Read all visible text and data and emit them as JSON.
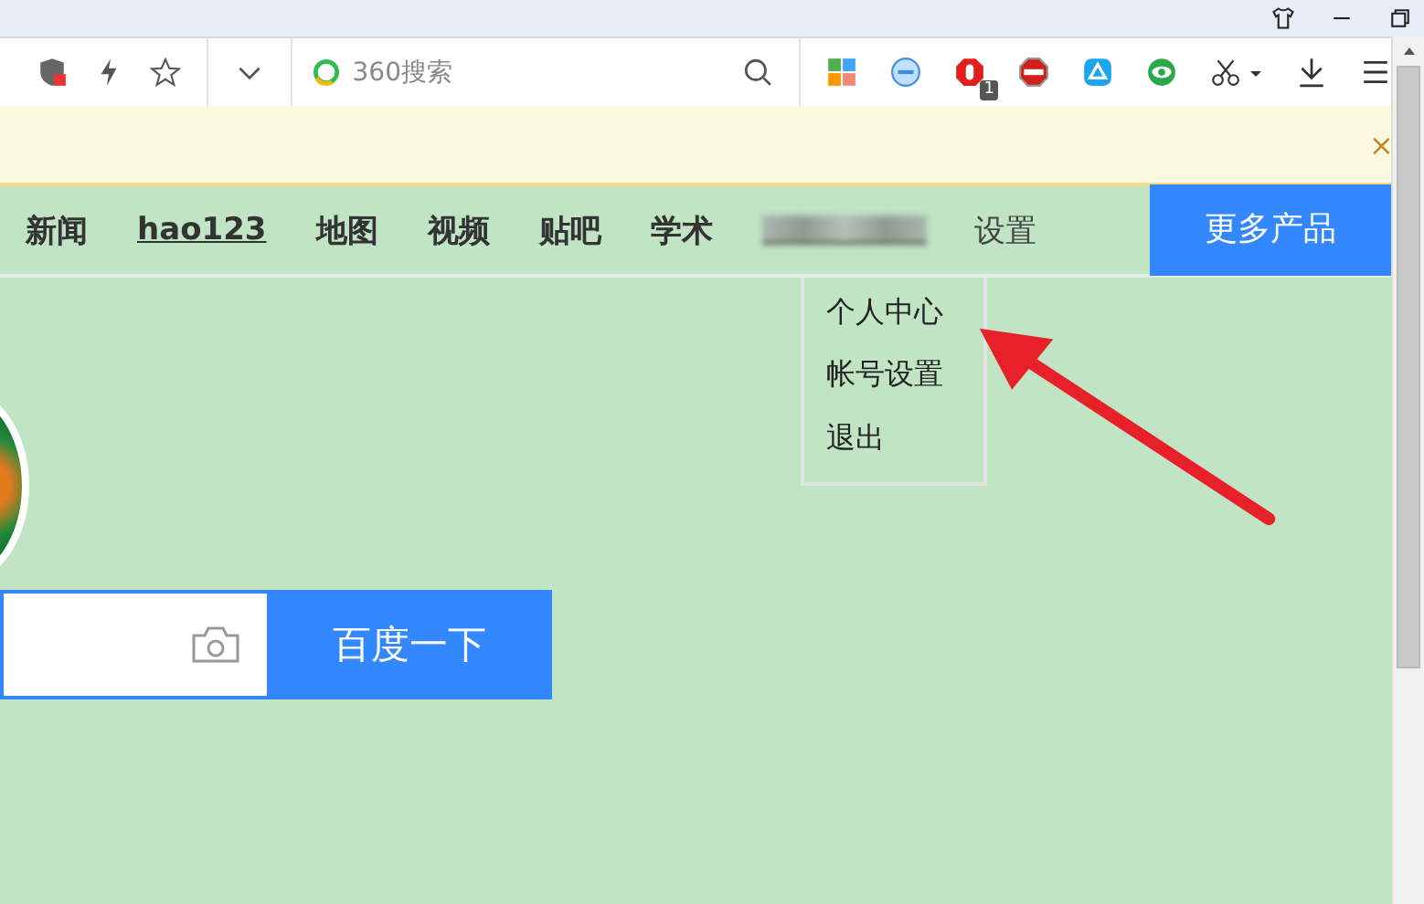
{
  "toolbar": {
    "search_placeholder": "360搜索",
    "extension_badge": "1"
  },
  "notice_bar": {
    "close": "×"
  },
  "nav": {
    "items": [
      {
        "label": "新闻",
        "underlined": false
      },
      {
        "label": "hao123",
        "underlined": true
      },
      {
        "label": "地图",
        "underlined": false
      },
      {
        "label": "视频",
        "underlined": false
      },
      {
        "label": "贴吧",
        "underlined": false
      },
      {
        "label": "学术",
        "underlined": false
      }
    ],
    "settings": "设置",
    "more_button": "更多产品"
  },
  "user_menu": {
    "items": [
      "个人中心",
      "帐号设置",
      "退出"
    ]
  },
  "search": {
    "button": "百度一下"
  }
}
